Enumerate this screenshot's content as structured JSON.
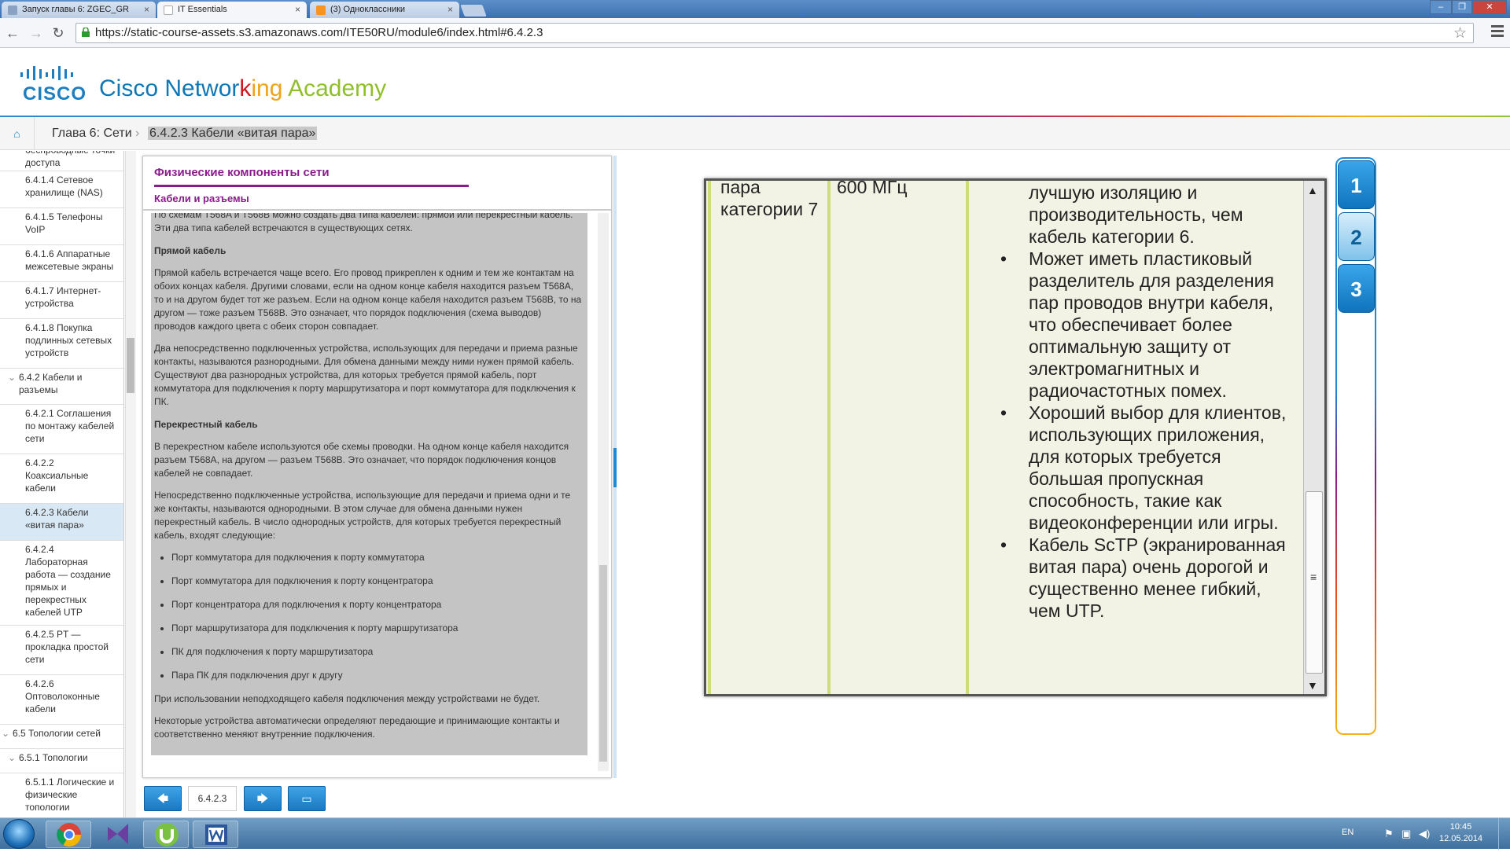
{
  "browser": {
    "tabs": [
      {
        "title": "Запуск главы 6: ZGEC_GR",
        "close": "×"
      },
      {
        "title": "IT Essentials",
        "close": "×"
      },
      {
        "title": "(3) Одноклассники",
        "close": "×"
      }
    ],
    "url": "https://static-course-assets.s3.amazonaws.com/ITE50RU/module6/index.html#6.4.2.3",
    "icons": [
      "back-icon",
      "forward-icon",
      "reload-icon",
      "lock-icon",
      "star-icon",
      "menu-icon"
    ]
  },
  "header": {
    "logo_word": "CISCO",
    "brand": {
      "a": "Cisco Networ",
      "b": "k",
      "c": "ing ",
      "d": "Academy"
    }
  },
  "breadcrumb": {
    "home_icon": "home-icon",
    "chapter": "Глава 6: Сети",
    "sep": "›",
    "current": "6.4.2.3 Кабели «витая пара»"
  },
  "nav": {
    "items": [
      {
        "label": "беспроводные точки доступа",
        "level": 2
      },
      {
        "label": "6.4.1.4 Сетевое хранилище (NAS)",
        "level": 2
      },
      {
        "label": "6.4.1.5 Телефоны VoIP",
        "level": 2
      },
      {
        "label": "6.4.1.6 Аппаратные межсетевые экраны",
        "level": 2
      },
      {
        "label": "6.4.1.7 Интернет-устройства",
        "level": 2
      },
      {
        "label": "6.4.1.8 Покупка подлинных сетевых устройств",
        "level": 2
      },
      {
        "label": "6.4.2 Кабели и разъемы",
        "level": 1,
        "toggle": "⌄"
      },
      {
        "label": "6.4.2.1 Соглашения по монтажу кабелей сети",
        "level": 2
      },
      {
        "label": "6.4.2.2 Коаксиальные кабели",
        "level": 2
      },
      {
        "label": "6.4.2.3 Кабели «витая пара»",
        "level": 2,
        "selected": true
      },
      {
        "label": "6.4.2.4 Лабораторная работа — создание прямых и перекрестных кабелей UTP",
        "level": 2
      },
      {
        "label": "6.4.2.5 PT — прокладка простой сети",
        "level": 2
      },
      {
        "label": "6.4.2.6 Оптоволоконные кабели",
        "level": 2
      },
      {
        "label": "6.5 Топологии сетей",
        "level": 0,
        "toggle": "⌄"
      },
      {
        "label": "6.5.1 Топологии",
        "level": 1,
        "toggle": "⌄"
      },
      {
        "label": "6.5.1.1 Логические и физические топологии",
        "level": 2
      }
    ]
  },
  "textpanel": {
    "title": "Физические компоненты сети",
    "subtitle": "Кабели и разъемы",
    "p0": "По схемам T568A и T568B можно создать два типа кабелей: прямой или перекрестный кабель. Эти два типа кабелей встречаются в существующих сетях.",
    "h1": "Прямой кабель",
    "p1": "Прямой кабель встречается чаще всего. Его провод прикреплен к одним и тем же контактам на обоих концах кабеля. Другими словами, если на одном конце кабеля находится разъем T568A, то и на другом будет тот же разъем. Если на одном конце кабеля находится разъем T568B, то на другом — тоже разъем T568B. Это означает, что порядок подключения (схема выводов) проводов каждого цвета с обеих сторон совпадает.",
    "p2": "Два непосредственно подключенных устройства, использующих для передачи и приема разные контакты, называются разнородными. Для обмена данными между ними нужен прямой кабель. Существуют два разнородных устройства, для которых требуется прямой кабель, порт коммутатора для подключения к порту маршрутизатора и порт коммутатора для подключения к ПК.",
    "h2": "Перекрестный кабель",
    "p3": "В перекрестном кабеле используются обе схемы проводки. На одном конце кабеля находится разъем T568A, на другом — разъем T568B. Это означает, что порядок подключения концов кабелей не совпадает.",
    "p4": "Непосредственно подключенные устройства, использующие для передачи и приема одни и те же контакты, называются однородными. В этом случае для обмена данными нужен перекрестный кабель. В число однородных устройств, для которых требуется перекрестный кабель, входят следующие:",
    "list": [
      "Порт коммутатора для подключения к порту коммутатора",
      "Порт коммутатора для подключения к порту концентратора",
      "Порт концентратора для подключения к порту концентратора",
      "Порт маршрутизатора для подключения к порту маршрутизатора",
      "ПК для подключения к порту маршрутизатора",
      "Пара ПК для подключения друг к другу"
    ],
    "p5": "При использовании неподходящего кабеля подключения между устройствами не будет.",
    "p6": "Некоторые устройства автоматически определяют передающие и принимающие контакты и соответственно меняют внутренние подключения."
  },
  "bottomnav": {
    "prev": "🡄",
    "page": "6.4.2.3",
    "next": "🡆",
    "screen": "▭"
  },
  "media": {
    "col1": "пара категории 7",
    "col2": "600 МГц",
    "col3_top": "лучшую изоляцию и производительность, чем кабель категории 6.",
    "bullets": [
      "Может иметь пластиковый разделитель для разделения пар проводов внутри кабеля, что обеспечивает более оптимальную защиту от электромагнитных и радиочастотных помех.",
      "Хороший выбор для клиентов, использующих приложения, для которых требуется большая пропускная способность, такие как видеоконференции или игры.",
      "Кабель ScTP (экранированная витая пара) очень дорогой и существенно менее гибкий, чем UTP."
    ],
    "bullet_char": "•",
    "scroll_up": "▲",
    "scroll_down": "▼",
    "grip": "≡"
  },
  "sidetabs": [
    "1",
    "2",
    "3"
  ],
  "taskbar": {
    "lang": "EN",
    "time": "10:45",
    "date": "12.05.2014"
  }
}
